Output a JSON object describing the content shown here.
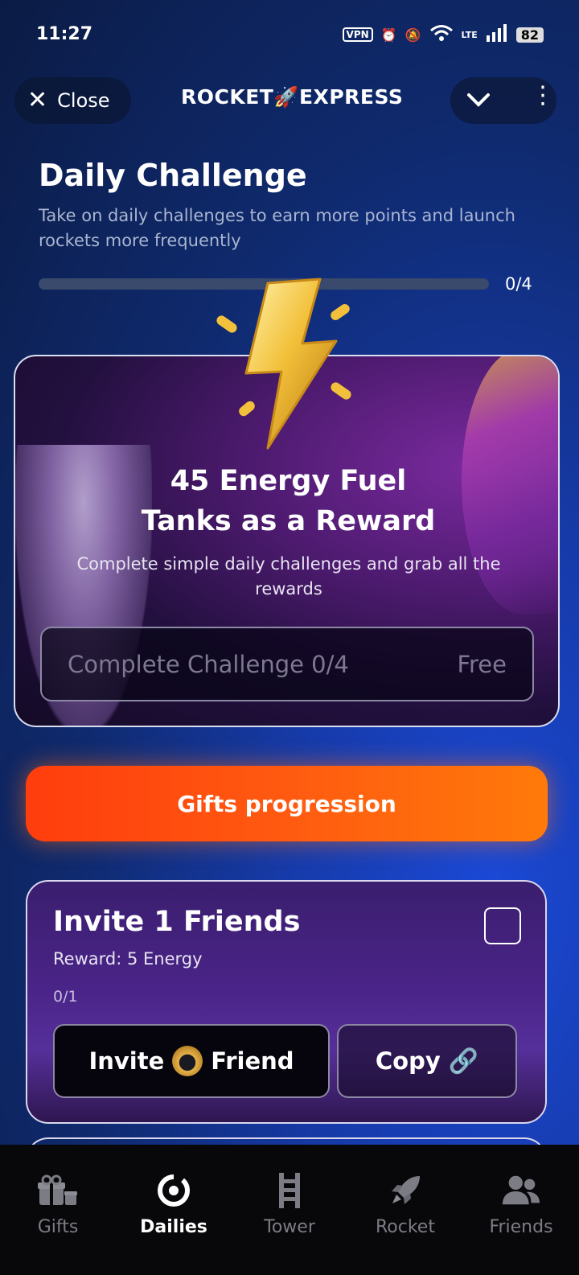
{
  "status_bar": {
    "time": "11:27",
    "vpn": "VPN",
    "battery": "82",
    "network": "LTE"
  },
  "header": {
    "close_label": "Close",
    "brand": "ROCKET🚀EXPRESS"
  },
  "page": {
    "title": "Daily Challenge",
    "subtitle": "Take on daily challenges to earn more points and launch rockets more frequently",
    "progress_label": "0/4",
    "progress_fraction": 0
  },
  "challenge_card": {
    "title_line1": "45 Energy Fuel",
    "title_line2": "Tanks as a Reward",
    "subtitle": "Complete simple daily challenges and grab all the rewards",
    "button_label": "Complete Challenge 0/4",
    "button_price": "Free"
  },
  "gifts_button": {
    "label": "Gifts progression"
  },
  "invite_card": {
    "title": "Invite 1 Friends",
    "reward": "Reward: 5 Energy",
    "count": "0/1",
    "invite_label_a": "Invite",
    "invite_label_b": "Friend",
    "copy_label": "Copy"
  },
  "nav": {
    "items": [
      {
        "label": "Gifts",
        "icon": "gift-icon"
      },
      {
        "label": "Dailies",
        "icon": "target-icon"
      },
      {
        "label": "Tower",
        "icon": "ladder-icon"
      },
      {
        "label": "Rocket",
        "icon": "rocket-icon"
      },
      {
        "label": "Friends",
        "icon": "people-icon"
      }
    ],
    "active": "Dailies"
  },
  "colors": {
    "accent_orange": "#ff5a10",
    "progress_fill": "#ffb400"
  }
}
